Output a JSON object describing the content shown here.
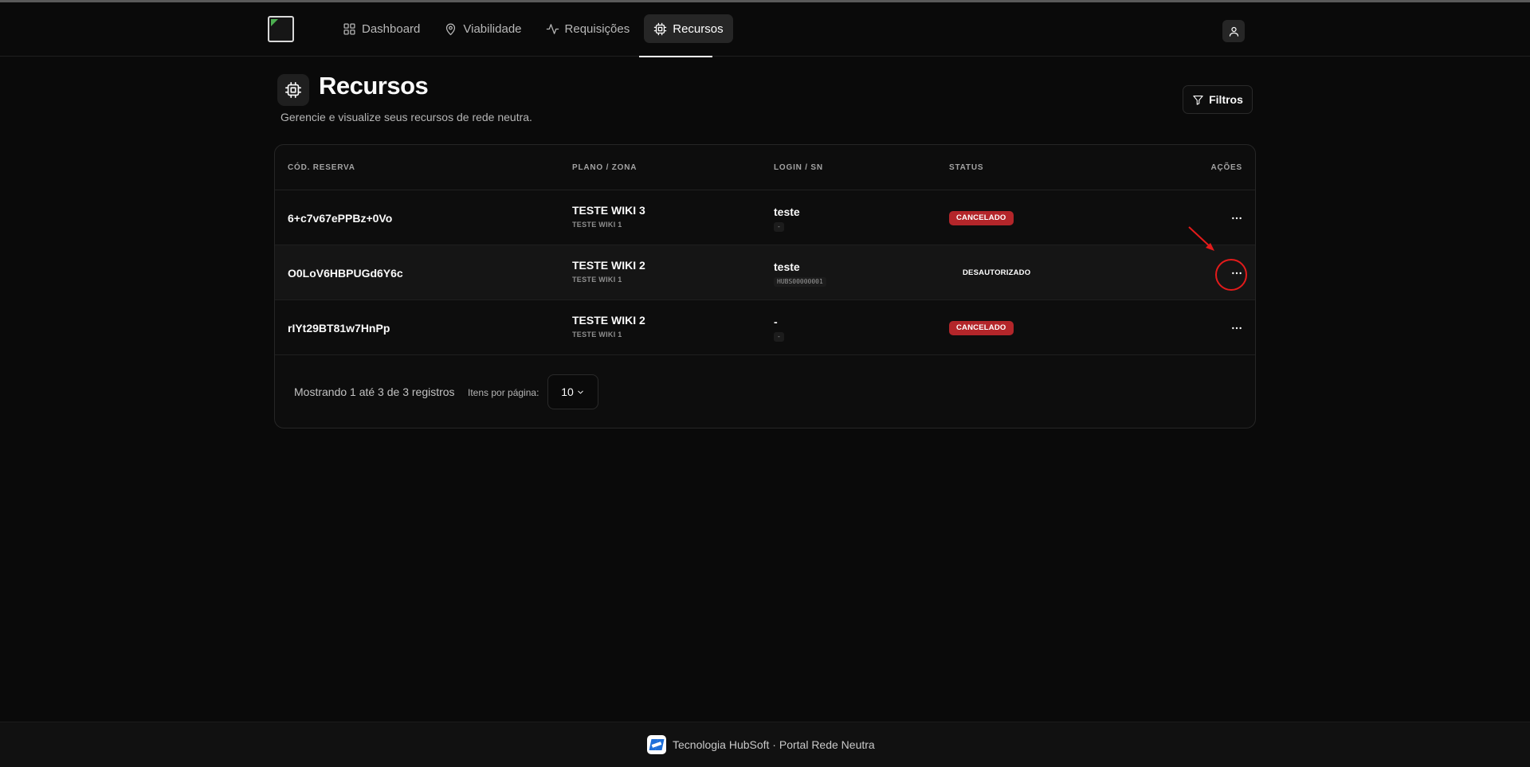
{
  "nav": {
    "items": [
      {
        "label": "Dashboard",
        "icon": "grid-icon",
        "active": false
      },
      {
        "label": "Viabilidade",
        "icon": "map-pin-icon",
        "active": false
      },
      {
        "label": "Requisições",
        "icon": "activity-icon",
        "active": false
      },
      {
        "label": "Recursos",
        "icon": "cpu-icon",
        "active": true
      }
    ]
  },
  "page": {
    "title": "Recursos",
    "subtitle": "Gerencie e visualize seus recursos de rede neutra.",
    "filter_label": "Filtros"
  },
  "table": {
    "headers": {
      "code": "CÓD. RESERVA",
      "plan": "PLANO / ZONA",
      "login": "LOGIN / SN",
      "status": "STATUS",
      "actions": "AÇÕES"
    },
    "rows": [
      {
        "code": "6+c7v67ePPBz+0Vo",
        "plan": "TESTE WIKI 3",
        "zone": "TESTE WIKI 1",
        "login": "teste",
        "sn": "-",
        "status": "CANCELADO"
      },
      {
        "code": "O0LoV6HBPUGd6Y6c",
        "plan": "TESTE WIKI 2",
        "zone": "TESTE WIKI 1",
        "login": "teste",
        "sn": "HUBS00000001",
        "status": "DESAUTORIZADO"
      },
      {
        "code": "rIYt29BT81w7HnPp",
        "plan": "TESTE WIKI 2",
        "zone": "TESTE WIKI 1",
        "login": "-",
        "sn": "-",
        "status": "CANCELADO"
      }
    ],
    "footer": {
      "showing": "Mostrando 1 até 3 de 3 registros",
      "per_page_label": "Itens por página:",
      "per_page_value": "10"
    }
  },
  "colors": {
    "background": "#0a0a0a",
    "cancel_badge": "#b3262a",
    "annotation": "#e31b1b"
  },
  "footer": {
    "text": "Tecnologia HubSoft · Portal Rede Neutra"
  }
}
